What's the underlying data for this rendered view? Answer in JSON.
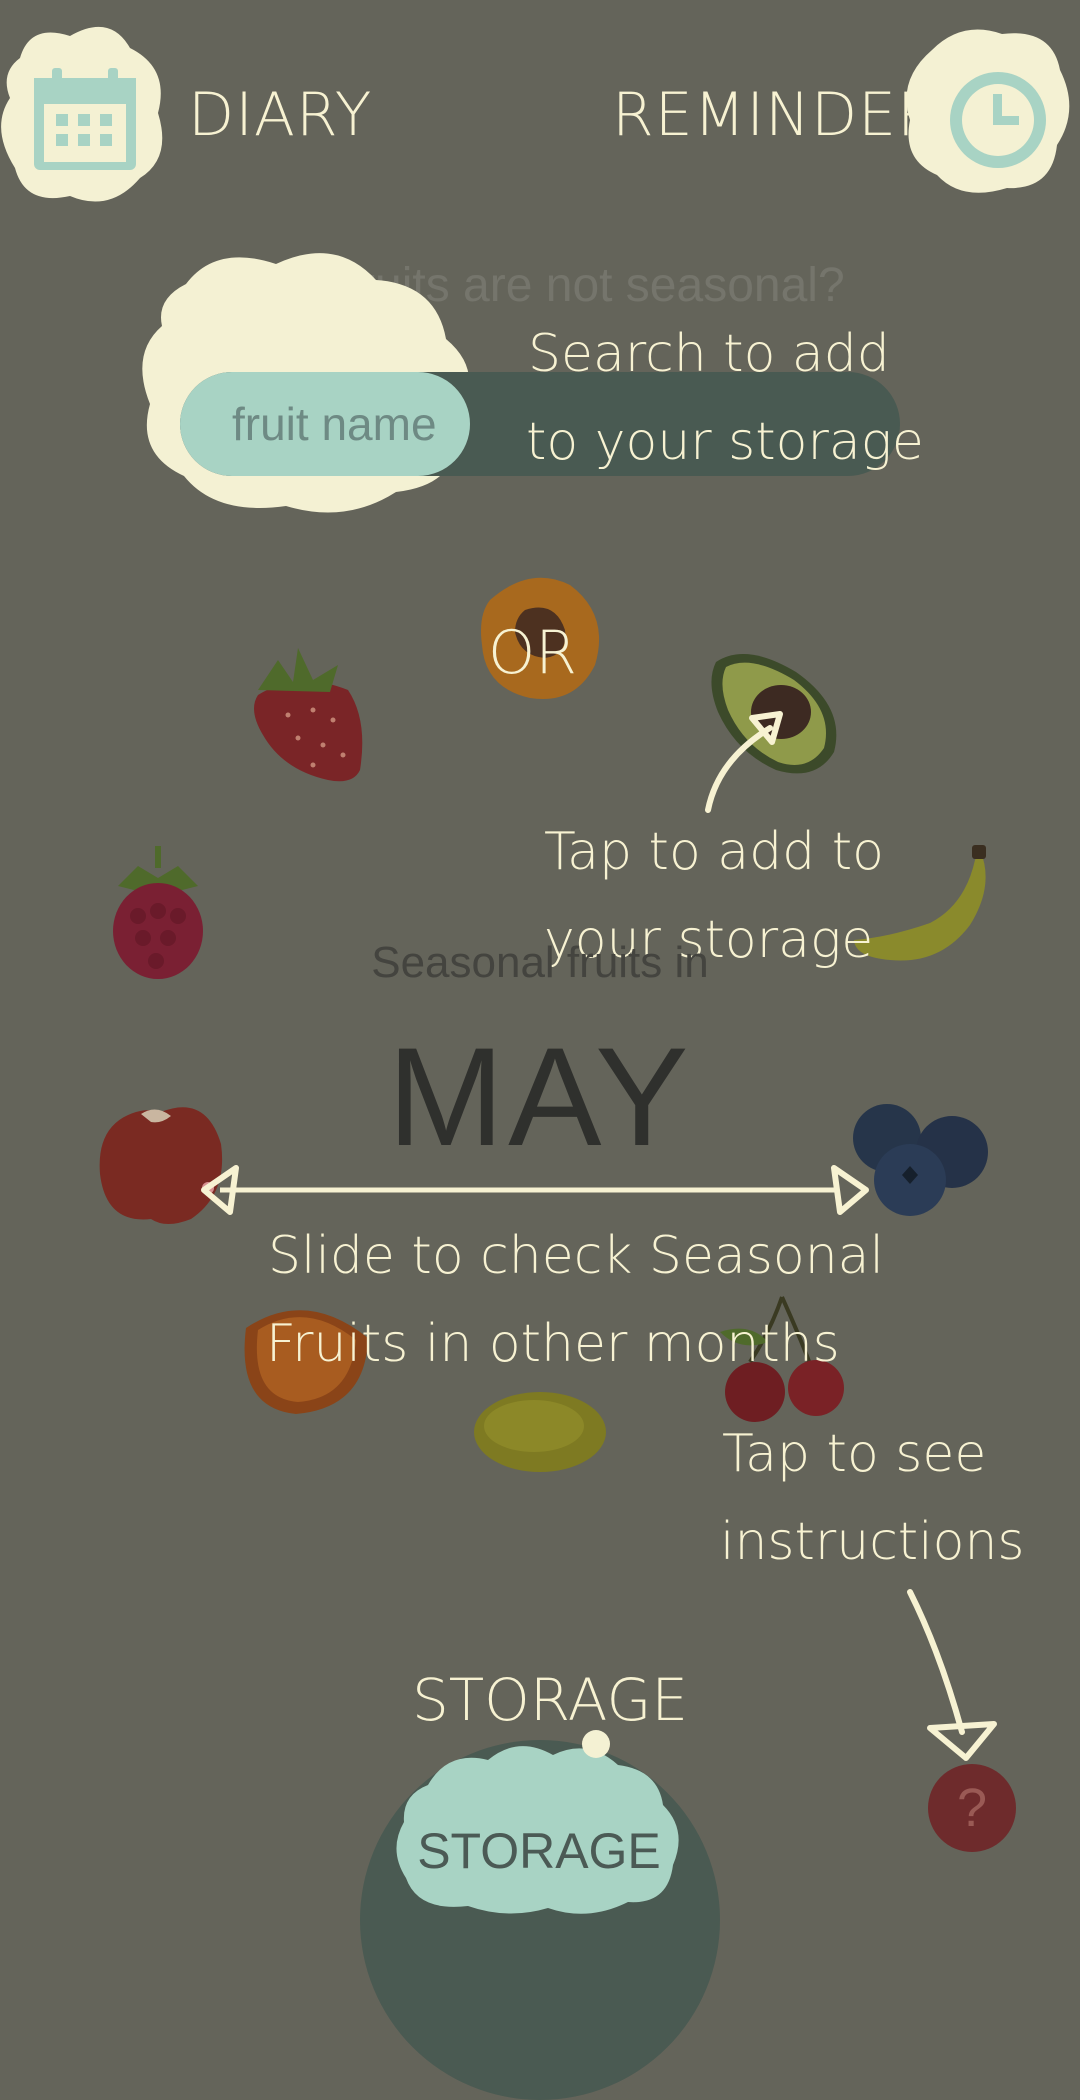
{
  "header": {
    "diary_label": "DIARY",
    "reminder_label": "REMINDER"
  },
  "search": {
    "question": "Your fruits are not seasonal?",
    "placeholder": "fruit name",
    "hint_line1": "Search to add",
    "hint_line2": "to your storage"
  },
  "or_label": "OR",
  "tap_hint": {
    "line1": "Tap to add to",
    "line2": "your storage"
  },
  "season": {
    "heading": "Seasonal fruits in",
    "month": "MAY"
  },
  "slide_hint": {
    "line1": "Slide to check Seasonal",
    "line2": "Fruits in other months"
  },
  "help_hint": {
    "line1": "Tap to see",
    "line2": "instructions"
  },
  "footer": {
    "storage_title": "STORAGE",
    "storage_button": "STORAGE",
    "help_symbol": "?"
  },
  "fruits": [
    "apricot",
    "strawberry",
    "avocado",
    "raspberry",
    "banana",
    "apple",
    "blueberries",
    "orange",
    "cherries",
    "lemon"
  ],
  "colors": {
    "overlay": "#64645a",
    "cream": "#f4f1d3",
    "mint": "#a8d3c4",
    "dark_teal": "#495a52",
    "help_red": "#6e2b2c"
  }
}
